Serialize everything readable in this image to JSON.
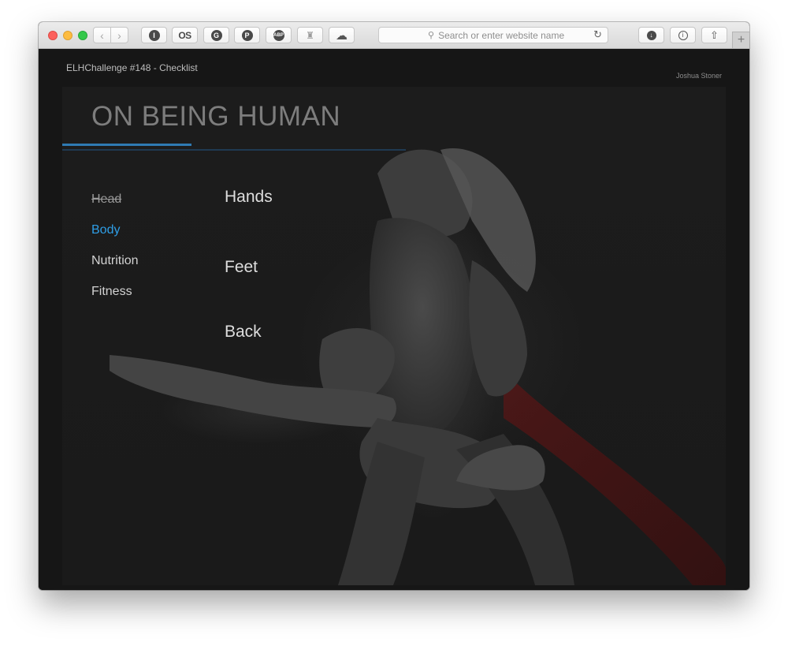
{
  "browser": {
    "address_placeholder": "Search or enter website name",
    "extensions": [
      {
        "name": "1password-icon",
        "glyph": "I"
      },
      {
        "name": "lastfm-icon",
        "glyph": "OS"
      },
      {
        "name": "grammarly-icon",
        "glyph": "G"
      },
      {
        "name": "pinterest-icon",
        "glyph": "P"
      },
      {
        "name": "adblock-icon",
        "glyph": "ABP"
      },
      {
        "name": "ghostery-icon",
        "glyph": "♜"
      },
      {
        "name": "icloud-icon",
        "glyph": "☁"
      }
    ]
  },
  "page": {
    "header": "ELHChallenge #148 - Checklist",
    "author": "Joshua Stoner",
    "title": "ON BEING HUMAN",
    "menu": [
      {
        "label": "Head",
        "state": "done"
      },
      {
        "label": "Body",
        "state": "active"
      },
      {
        "label": "Nutrition",
        "state": "default"
      },
      {
        "label": "Fitness",
        "state": "default"
      }
    ],
    "sub_items": [
      "Hands",
      "Feet",
      "Back"
    ]
  },
  "colors": {
    "accent": "#2f9ee6",
    "underline": "#2f7ab3",
    "background": "#161616"
  }
}
